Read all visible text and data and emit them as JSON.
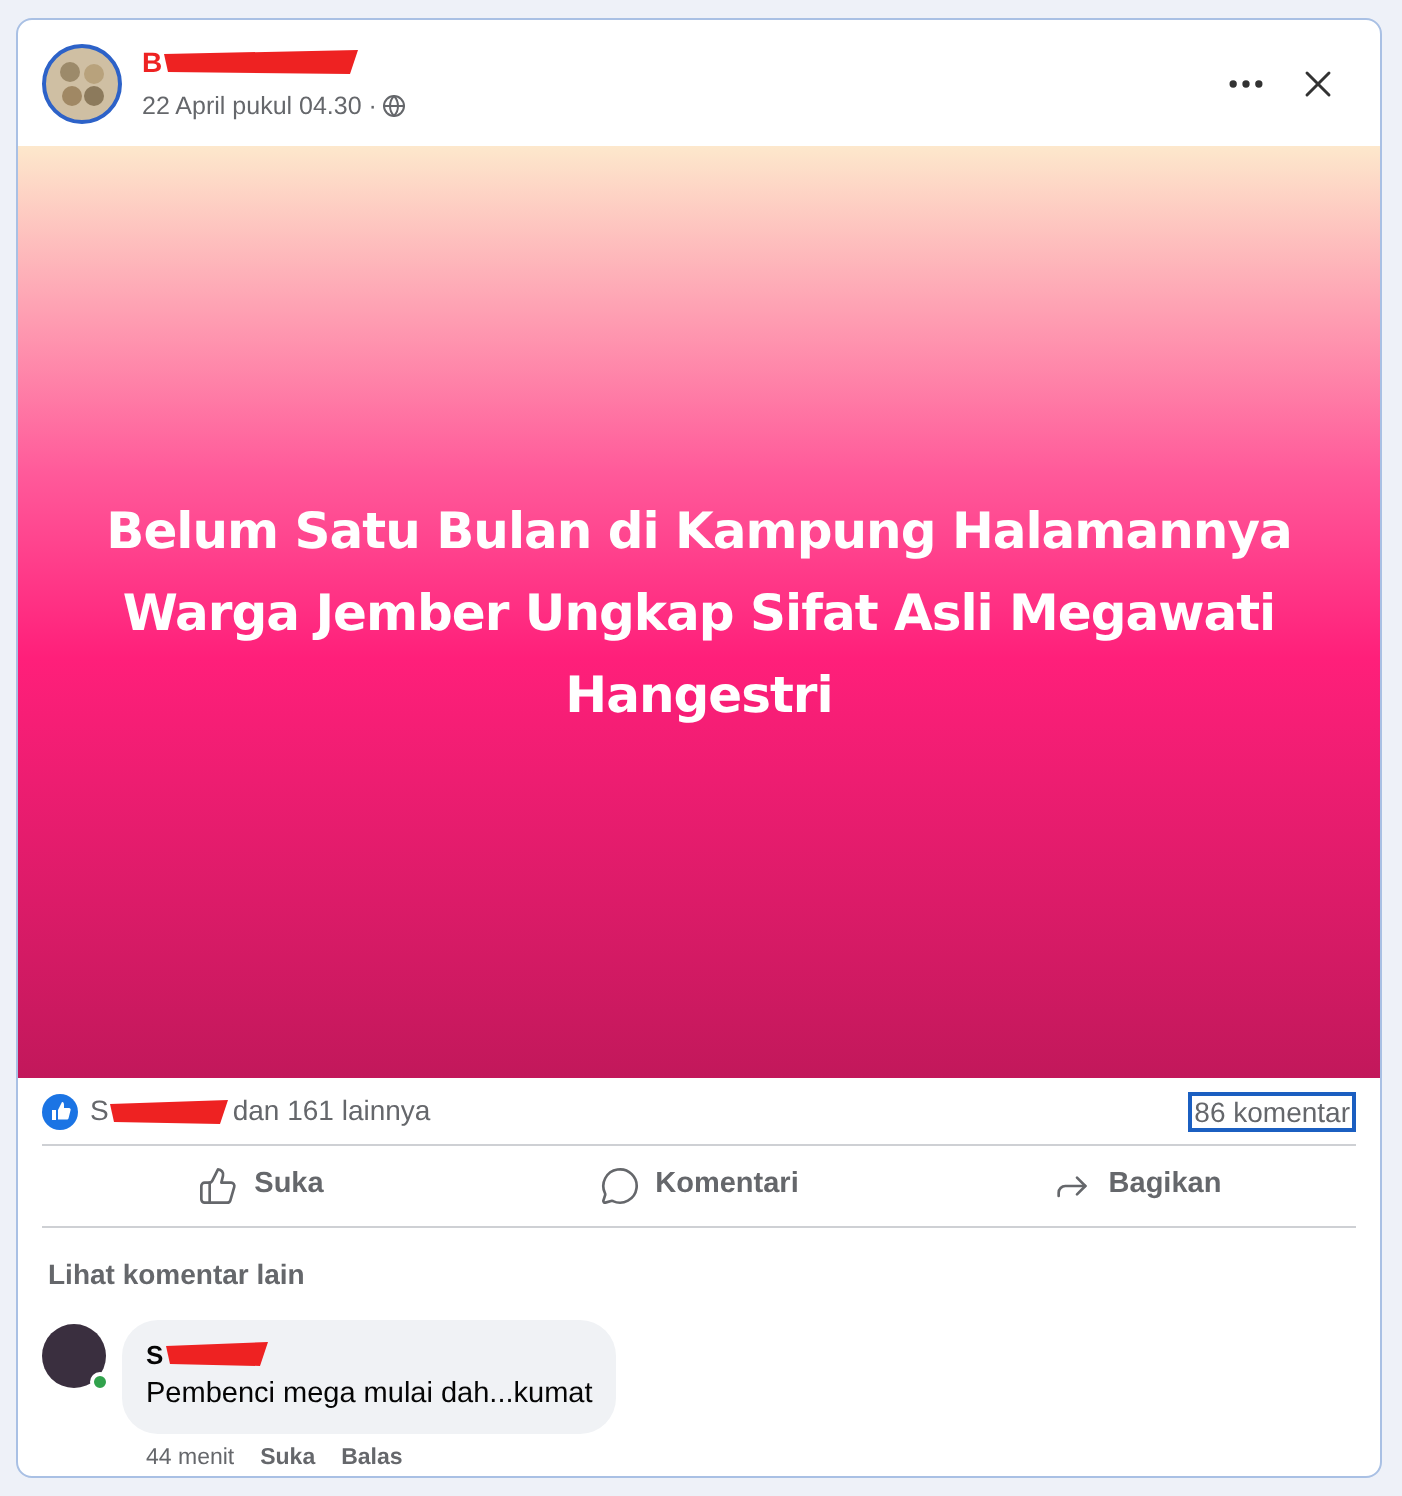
{
  "post": {
    "author_initial": "B",
    "timestamp": "22 April pukul 04.30 ·",
    "headline": "Belum Satu Bulan di Kampung Halamannya Warga Jember Ungkap Sifat Asli Megawati Hangestri"
  },
  "stats": {
    "likers_initial": "S",
    "likers_rest": "dan 161 lainnya",
    "comments": "86 komentar"
  },
  "actions": [
    {
      "kind": "like",
      "label": "Suka"
    },
    {
      "kind": "comment",
      "label": "Komentari"
    },
    {
      "kind": "share",
      "label": "Bagikan"
    }
  ],
  "more_comments": "Lihat komentar lain",
  "comments": [
    {
      "author_initial": "S",
      "online": true,
      "text": "Pembenci mega mulai dah...kumat",
      "time": "44 menit",
      "like": "Suka",
      "reply": "Balas"
    }
  ]
}
